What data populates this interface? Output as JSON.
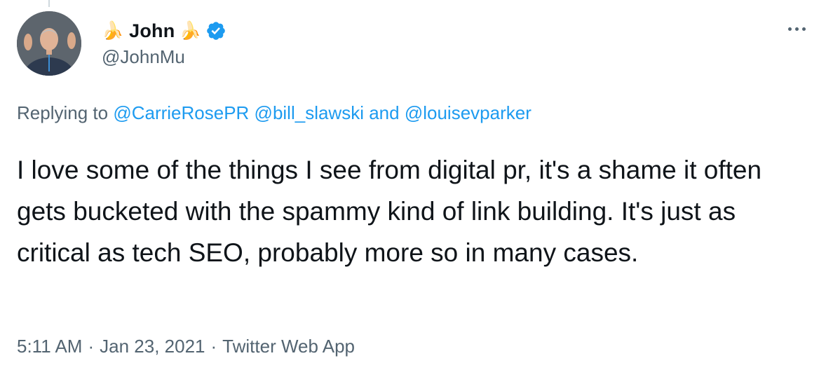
{
  "author": {
    "display_name": "John",
    "emoji_left": "🍌",
    "emoji_right": "🍌",
    "handle": "@JohnMu",
    "verified": true
  },
  "menu": {
    "icon": "more-horizontal-icon"
  },
  "reply": {
    "prefix": "Replying to",
    "mentions": [
      "@CarrieRosePR",
      "@bill_slawski",
      "@louisevparker"
    ],
    "conjunction": "and"
  },
  "tweet": {
    "text": "I love some of the things I see from digital pr, it's a shame it often gets bucketed with the spammy kind of link building. It's just as critical as tech SEO, probably more so in many cases."
  },
  "meta": {
    "time": "5:11 AM",
    "separator": "·",
    "date": "Jan 23, 2021",
    "source": "Twitter Web App"
  },
  "colors": {
    "accent": "#1d9bf0",
    "secondary_text": "#536471",
    "primary_text": "#0f1419"
  }
}
